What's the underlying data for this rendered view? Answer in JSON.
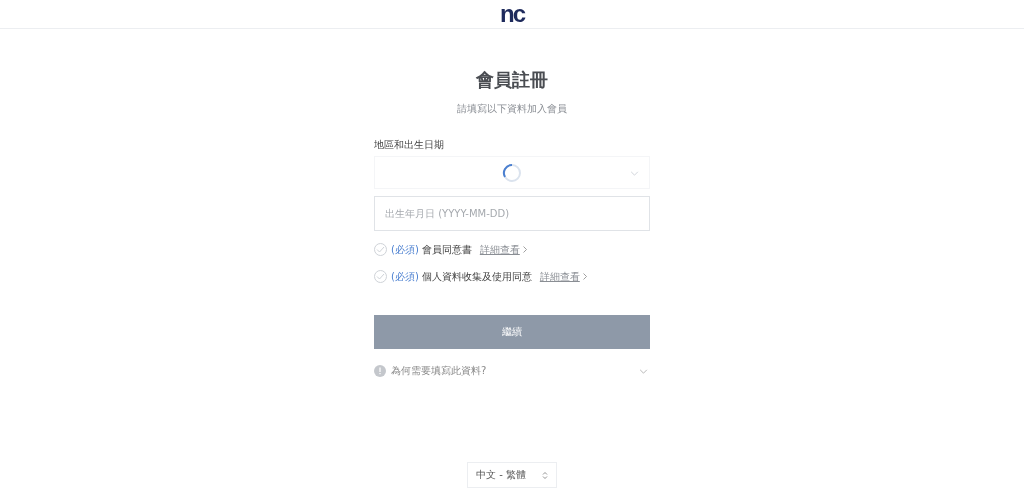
{
  "header": {
    "logo": "nc"
  },
  "title": "會員註冊",
  "subtitle": "請填寫以下資料加入會員",
  "section_label": "地區和出生日期",
  "region_select": {
    "loading": true
  },
  "birth_field": {
    "placeholder": "出生年月日 (YYYY-MM-DD)"
  },
  "agreements": [
    {
      "required": "(必須)",
      "label": "會員同意書",
      "link": "詳細查看",
      "checked": false
    },
    {
      "required": "(必須)",
      "label": "個人資料收集及使用同意",
      "link": "詳細查看",
      "checked": false
    }
  ],
  "submit": {
    "label": "繼續",
    "disabled": true
  },
  "info": {
    "text": "為何需要填寫此資料?",
    "expanded": false
  },
  "language": {
    "label": "中文 - 繁體"
  }
}
